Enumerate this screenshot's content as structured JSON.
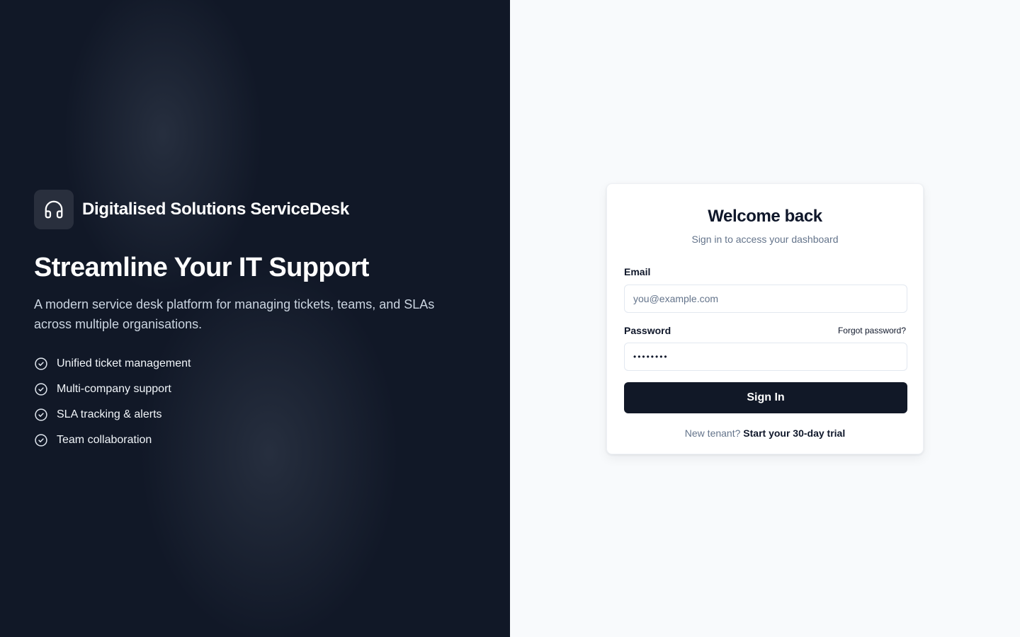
{
  "brand": {
    "name": "Digitalised Solutions ServiceDesk",
    "icon": "headphones-icon"
  },
  "hero": {
    "title": "Streamline Your IT Support",
    "description": "A modern service desk platform for managing tickets, teams, and SLAs across multiple organisations."
  },
  "features": [
    {
      "label": "Unified ticket management",
      "icon": "check-circle-icon"
    },
    {
      "label": "Multi-company support",
      "icon": "check-circle-icon"
    },
    {
      "label": "SLA tracking & alerts",
      "icon": "check-circle-icon"
    },
    {
      "label": "Team collaboration",
      "icon": "check-circle-icon"
    }
  ],
  "login": {
    "title": "Welcome back",
    "subtitle": "Sign in to access your dashboard",
    "email_label": "Email",
    "email_placeholder": "you@example.com",
    "email_value": "",
    "password_label": "Password",
    "password_value": "password",
    "forgot_label": "Forgot password?",
    "submit_label": "Sign In",
    "footer_text": "New tenant?",
    "footer_link": "Start your 30-day trial"
  },
  "colors": {
    "left_panel_bg": "#111827",
    "right_panel_bg": "#f8fafc",
    "primary_button": "#111827",
    "muted_text": "#64748b"
  }
}
